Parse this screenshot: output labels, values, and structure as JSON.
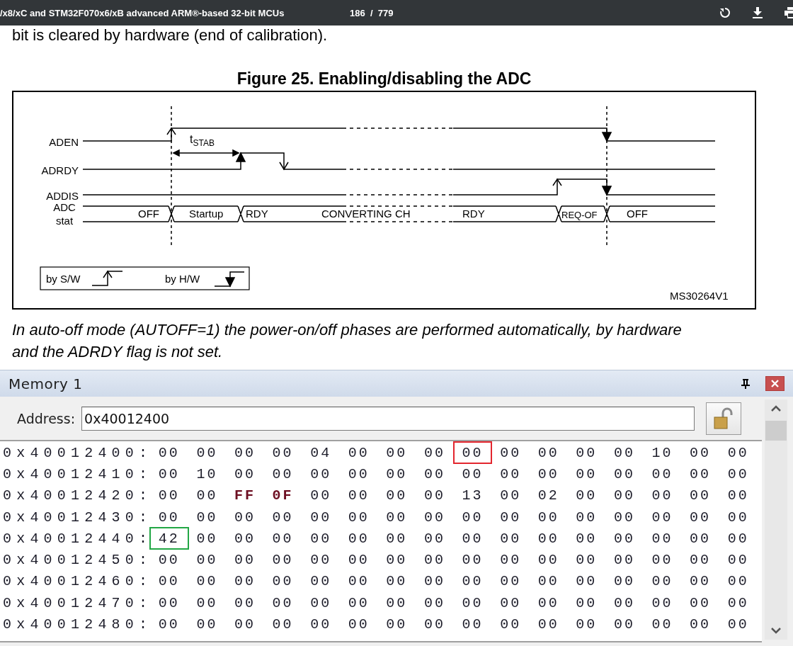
{
  "viewer": {
    "title": "/x8/xC and STM32F070x6/xB advanced ARM®-based 32-bit MCUs",
    "page_counter": "186  /  779"
  },
  "document": {
    "intro": "bit is cleared by hardware (end of calibration).",
    "figure": {
      "caption": "Figure 25. Enabling/disabling the ADC",
      "signals": [
        {
          "label": "ADEN"
        },
        {
          "label": "ADRDY"
        },
        {
          "label": "ADDIS"
        },
        {
          "label": "ADC stat"
        }
      ],
      "states": [
        "OFF",
        "Startup",
        "RDY",
        "CONVERTING CH",
        "RDY",
        "REQ-OF",
        "OFF"
      ],
      "interval": "t$_{STAB}$",
      "legend": [
        "by S/W",
        "by H/W"
      ],
      "figure_id": "MS30264V1"
    },
    "note": "In auto-off mode (AUTOFF=1) the power-on/off phases are performed automatically, by hardware and the ADRDY flag is not set."
  },
  "memory": {
    "title": "Memory 1",
    "address_label": "Address:",
    "address": "0x40012400",
    "rows": [
      {
        "address": "0x40012400:",
        "bytes": [
          {
            "value": "00",
            "changed": false
          },
          {
            "value": "00",
            "changed": false
          },
          {
            "value": "00",
            "changed": false
          },
          {
            "value": "00",
            "changed": false
          },
          {
            "value": "04",
            "changed": false
          },
          {
            "value": "00",
            "changed": false
          },
          {
            "value": "00",
            "changed": false
          },
          {
            "value": "00",
            "changed": false
          },
          {
            "value": "00",
            "changed": false,
            "color": "#e3262e"
          },
          {
            "value": "00",
            "changed": false
          },
          {
            "value": "00",
            "changed": false
          },
          {
            "value": "00",
            "changed": false
          },
          {
            "value": "00",
            "changed": false
          },
          {
            "value": "10",
            "changed": false
          },
          {
            "value": "00",
            "changed": false
          },
          {
            "value": "00",
            "changed": false
          }
        ]
      },
      {
        "address": "0x40012410:",
        "bytes": [
          {
            "value": "00",
            "changed": false
          },
          {
            "value": "10",
            "changed": false
          },
          {
            "value": "00",
            "changed": false
          },
          {
            "value": "00",
            "changed": false
          },
          {
            "value": "00",
            "changed": false
          },
          {
            "value": "00",
            "changed": false
          },
          {
            "value": "00",
            "changed": false
          },
          {
            "value": "00",
            "changed": false
          },
          {
            "value": "00",
            "changed": false
          },
          {
            "value": "00",
            "changed": false
          },
          {
            "value": "00",
            "changed": false
          },
          {
            "value": "00",
            "changed": false
          },
          {
            "value": "00",
            "changed": false
          },
          {
            "value": "00",
            "changed": false
          },
          {
            "value": "00",
            "changed": false
          },
          {
            "value": "00",
            "changed": false
          }
        ]
      },
      {
        "address": "0x40012420:",
        "bytes": [
          {
            "value": "00",
            "changed": false
          },
          {
            "value": "00",
            "changed": false
          },
          {
            "value": "FF",
            "changed": true
          },
          {
            "value": "0F",
            "changed": true
          },
          {
            "value": "00",
            "changed": false
          },
          {
            "value": "00",
            "changed": false
          },
          {
            "value": "00",
            "changed": false
          },
          {
            "value": "00",
            "changed": false
          },
          {
            "value": "13",
            "changed": false
          },
          {
            "value": "00",
            "changed": false
          },
          {
            "value": "02",
            "changed": false
          },
          {
            "value": "00",
            "changed": false
          },
          {
            "value": "00",
            "changed": false
          },
          {
            "value": "00",
            "changed": false
          },
          {
            "value": "00",
            "changed": false
          },
          {
            "value": "00",
            "changed": false
          }
        ]
      },
      {
        "address": "0x40012430:",
        "bytes": [
          {
            "value": "00",
            "changed": false
          },
          {
            "value": "00",
            "changed": false
          },
          {
            "value": "00",
            "changed": false
          },
          {
            "value": "00",
            "changed": false
          },
          {
            "value": "00",
            "changed": false
          },
          {
            "value": "00",
            "changed": false
          },
          {
            "value": "00",
            "changed": false
          },
          {
            "value": "00",
            "changed": false
          },
          {
            "value": "00",
            "changed": false
          },
          {
            "value": "00",
            "changed": false
          },
          {
            "value": "00",
            "changed": false
          },
          {
            "value": "00",
            "changed": false
          },
          {
            "value": "00",
            "changed": false
          },
          {
            "value": "00",
            "changed": false
          },
          {
            "value": "00",
            "changed": false
          },
          {
            "value": "00",
            "changed": false
          }
        ]
      },
      {
        "address": "0x40012440:",
        "bytes": [
          {
            "value": "42",
            "changed": false,
            "color": "#22a745"
          },
          {
            "value": "00",
            "changed": false
          },
          {
            "value": "00",
            "changed": false
          },
          {
            "value": "00",
            "changed": false
          },
          {
            "value": "00",
            "changed": false
          },
          {
            "value": "00",
            "changed": false
          },
          {
            "value": "00",
            "changed": false
          },
          {
            "value": "00",
            "changed": false
          },
          {
            "value": "00",
            "changed": false
          },
          {
            "value": "00",
            "changed": false
          },
          {
            "value": "00",
            "changed": false
          },
          {
            "value": "00",
            "changed": false
          },
          {
            "value": "00",
            "changed": false
          },
          {
            "value": "00",
            "changed": false
          },
          {
            "value": "00",
            "changed": false
          },
          {
            "value": "00",
            "changed": false
          }
        ]
      },
      {
        "address": "0x40012450:",
        "bytes": [
          {
            "value": "00",
            "changed": false
          },
          {
            "value": "00",
            "changed": false
          },
          {
            "value": "00",
            "changed": false
          },
          {
            "value": "00",
            "changed": false
          },
          {
            "value": "00",
            "changed": false
          },
          {
            "value": "00",
            "changed": false
          },
          {
            "value": "00",
            "changed": false
          },
          {
            "value": "00",
            "changed": false
          },
          {
            "value": "00",
            "changed": false
          },
          {
            "value": "00",
            "changed": false
          },
          {
            "value": "00",
            "changed": false
          },
          {
            "value": "00",
            "changed": false
          },
          {
            "value": "00",
            "changed": false
          },
          {
            "value": "00",
            "changed": false
          },
          {
            "value": "00",
            "changed": false
          },
          {
            "value": "00",
            "changed": false
          }
        ]
      },
      {
        "address": "0x40012460:",
        "bytes": [
          {
            "value": "00",
            "changed": false
          },
          {
            "value": "00",
            "changed": false
          },
          {
            "value": "00",
            "changed": false
          },
          {
            "value": "00",
            "changed": false
          },
          {
            "value": "00",
            "changed": false
          },
          {
            "value": "00",
            "changed": false
          },
          {
            "value": "00",
            "changed": false
          },
          {
            "value": "00",
            "changed": false
          },
          {
            "value": "00",
            "changed": false
          },
          {
            "value": "00",
            "changed": false
          },
          {
            "value": "00",
            "changed": false
          },
          {
            "value": "00",
            "changed": false
          },
          {
            "value": "00",
            "changed": false
          },
          {
            "value": "00",
            "changed": false
          },
          {
            "value": "00",
            "changed": false
          },
          {
            "value": "00",
            "changed": false
          }
        ]
      },
      {
        "address": "0x40012470:",
        "bytes": [
          {
            "value": "00",
            "changed": false
          },
          {
            "value": "00",
            "changed": false
          },
          {
            "value": "00",
            "changed": false
          },
          {
            "value": "00",
            "changed": false
          },
          {
            "value": "00",
            "changed": false
          },
          {
            "value": "00",
            "changed": false
          },
          {
            "value": "00",
            "changed": false
          },
          {
            "value": "00",
            "changed": false
          },
          {
            "value": "00",
            "changed": false
          },
          {
            "value": "00",
            "changed": false
          },
          {
            "value": "00",
            "changed": false
          },
          {
            "value": "00",
            "changed": false
          },
          {
            "value": "00",
            "changed": false
          },
          {
            "value": "00",
            "changed": false
          },
          {
            "value": "00",
            "changed": false
          },
          {
            "value": "00",
            "changed": false
          }
        ]
      },
      {
        "address": "0x40012480:",
        "bytes": [
          {
            "value": "00",
            "changed": false
          },
          {
            "value": "00",
            "changed": false
          },
          {
            "value": "00",
            "changed": false
          },
          {
            "value": "00",
            "changed": false
          },
          {
            "value": "00",
            "changed": false
          },
          {
            "value": "00",
            "changed": false
          },
          {
            "value": "00",
            "changed": false
          },
          {
            "value": "00",
            "changed": false
          },
          {
            "value": "00",
            "changed": false
          },
          {
            "value": "00",
            "changed": false
          },
          {
            "value": "00",
            "changed": false
          },
          {
            "value": "00",
            "changed": false
          },
          {
            "value": "00",
            "changed": false
          },
          {
            "value": "00",
            "changed": false
          },
          {
            "value": "00",
            "changed": false
          },
          {
            "value": "00",
            "changed": false
          }
        ]
      }
    ]
  }
}
